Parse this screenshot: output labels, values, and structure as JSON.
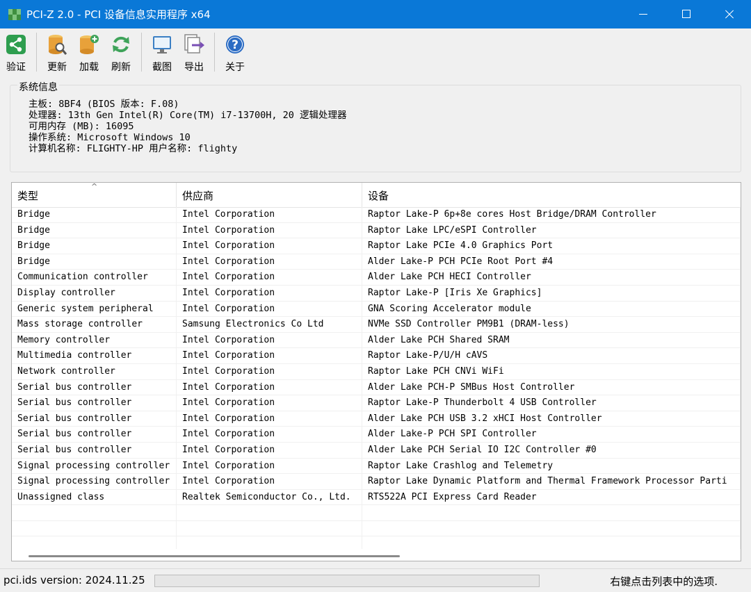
{
  "window": {
    "title": "PCI-Z 2.0  - PCI 设备信息实用程序 x64"
  },
  "toolbar": {
    "buttons": [
      {
        "label": "验证",
        "icon": "share-icon",
        "color": "#2e9e4f"
      },
      {
        "label": "更新",
        "icon": "database-search-icon",
        "color": "#e8a13a"
      },
      {
        "label": "加载",
        "icon": "database-add-icon",
        "color": "#e8a13a"
      },
      {
        "label": "刷新",
        "icon": "refresh-icon",
        "color": "#3fa35a"
      },
      {
        "label": "截图",
        "icon": "monitor-icon",
        "color": "#3b7fc4"
      },
      {
        "label": "导出",
        "icon": "export-icon",
        "color": "#7a4fb5"
      },
      {
        "label": "关于",
        "icon": "help-icon",
        "color": "#2b6cc4"
      }
    ]
  },
  "sysinfo": {
    "legend": "系统信息",
    "lines": [
      "主板: 8BF4 (BIOS 版本: F.08)",
      "处理器: 13th Gen Intel(R) Core(TM) i7-13700H, 20 逻辑处理器",
      "可用内存 (MB): 16095",
      "操作系统: Microsoft Windows 10",
      "计算机名称: FLIGHTY-HP  用户名称: flighty"
    ]
  },
  "table": {
    "columns": [
      "类型",
      "供应商",
      "设备"
    ],
    "rows": [
      [
        "Bridge",
        "Intel Corporation",
        "Raptor Lake-P 6p+8e cores Host Bridge/DRAM Controller"
      ],
      [
        "Bridge",
        "Intel Corporation",
        "Raptor Lake LPC/eSPI Controller"
      ],
      [
        "Bridge",
        "Intel Corporation",
        "Raptor Lake PCIe 4.0 Graphics Port"
      ],
      [
        "Bridge",
        "Intel Corporation",
        "Alder Lake-P PCH PCIe Root Port #4"
      ],
      [
        "Communication controller",
        "Intel Corporation",
        "Alder Lake PCH HECI Controller"
      ],
      [
        "Display controller",
        "Intel Corporation",
        "Raptor Lake-P [Iris Xe Graphics]"
      ],
      [
        "Generic system peripheral",
        "Intel Corporation",
        "GNA Scoring Accelerator module"
      ],
      [
        "Mass storage controller",
        "Samsung Electronics Co Ltd",
        "NVMe SSD Controller PM9B1 (DRAM-less)"
      ],
      [
        "Memory controller",
        "Intel Corporation",
        "Alder Lake PCH Shared SRAM"
      ],
      [
        "Multimedia controller",
        "Intel Corporation",
        "Raptor Lake-P/U/H cAVS"
      ],
      [
        "Network controller",
        "Intel Corporation",
        "Raptor Lake PCH CNVi WiFi"
      ],
      [
        "Serial bus controller",
        "Intel Corporation",
        "Alder Lake PCH-P SMBus Host Controller"
      ],
      [
        "Serial bus controller",
        "Intel Corporation",
        "Raptor Lake-P Thunderbolt 4 USB Controller"
      ],
      [
        "Serial bus controller",
        "Intel Corporation",
        "Alder Lake PCH USB 3.2 xHCI Host Controller"
      ],
      [
        "Serial bus controller",
        "Intel Corporation",
        "Alder Lake-P PCH SPI Controller"
      ],
      [
        "Serial bus controller",
        "Intel Corporation",
        "Alder Lake PCH Serial IO I2C Controller #0"
      ],
      [
        "Signal processing controller",
        "Intel Corporation",
        "Raptor Lake Crashlog and Telemetry"
      ],
      [
        "Signal processing controller",
        "Intel Corporation",
        "Raptor Lake Dynamic Platform and Thermal Framework Processor Parti"
      ],
      [
        "Unassigned class",
        "Realtek Semiconductor Co., Ltd.",
        "RTS522A PCI Express Card Reader"
      ]
    ]
  },
  "statusbar": {
    "version": "pci.ids version: 2024.11.25",
    "hint": "右键点击列表中的选项."
  }
}
